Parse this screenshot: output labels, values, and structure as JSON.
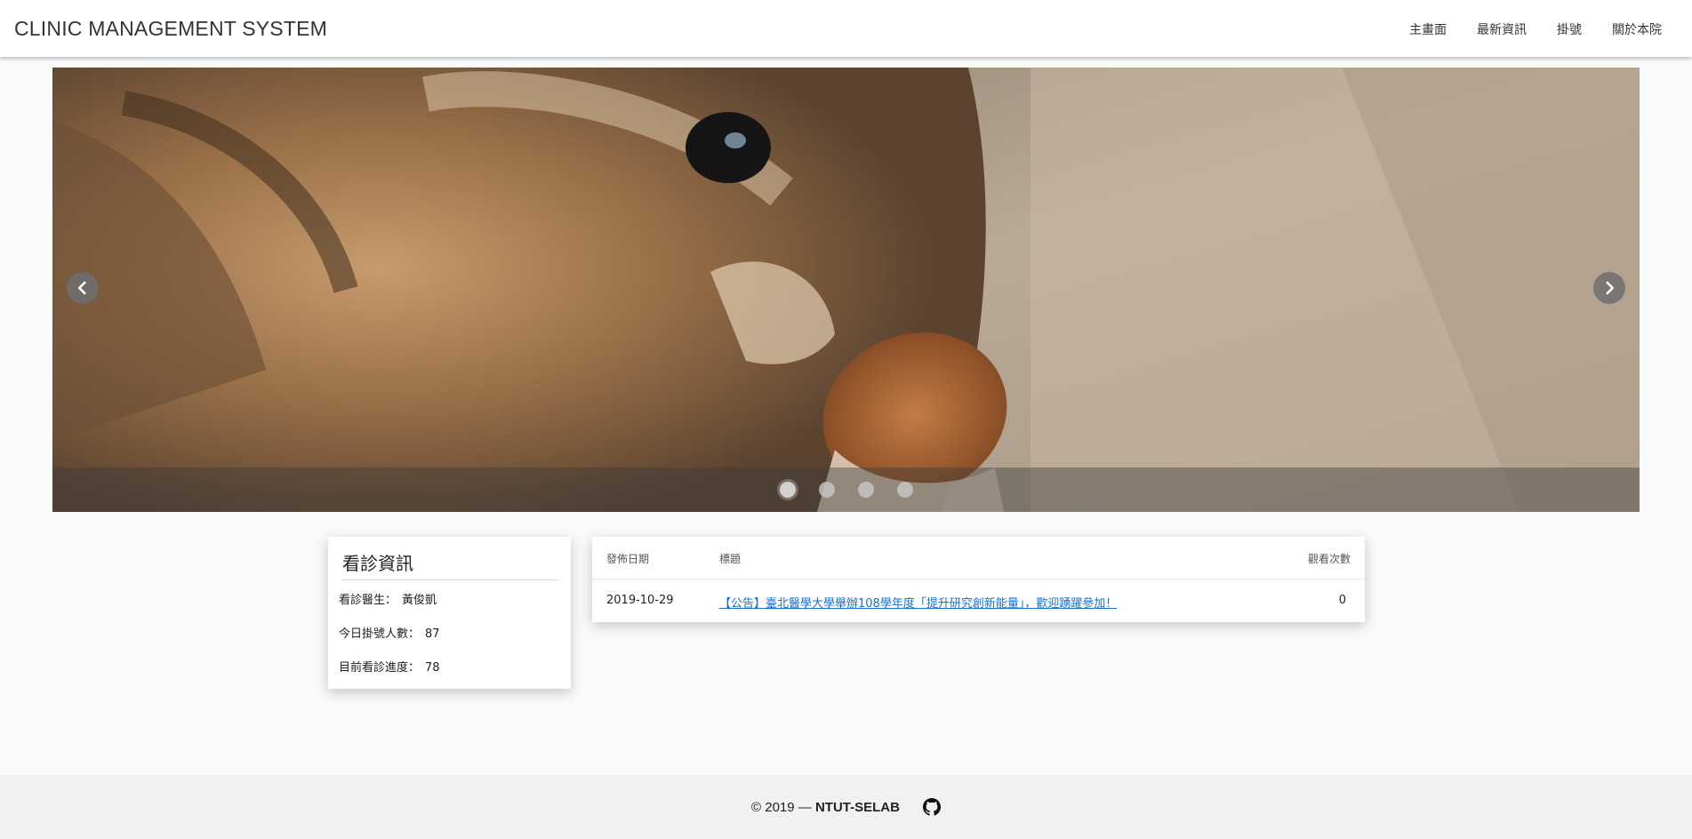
{
  "header": {
    "brand": "CLINIC MANAGEMENT SYSTEM",
    "nav": [
      {
        "label": "主畫面"
      },
      {
        "label": "最新資訊"
      },
      {
        "label": "掛號"
      },
      {
        "label": "關於本院"
      }
    ]
  },
  "carousel": {
    "slide_count": 4,
    "active_index": 0,
    "prev_icon": "chevron-left-icon",
    "next_icon": "chevron-right-icon"
  },
  "info": {
    "title": "看診資訊",
    "doctor_label": "看診醫生：",
    "doctor_value": "黃俊凱",
    "today_label": "今日掛號人數：",
    "today_value": "87",
    "progress_label": "目前看診進度：",
    "progress_value": "78"
  },
  "news": {
    "headers": {
      "date": "發佈日期",
      "title": "標題",
      "views": "觀看次數"
    },
    "rows": [
      {
        "date": "2019-10-29",
        "title": "【公告】臺北醫學大學舉辦108學年度「提升研究創新能量」，歡迎踴躍參加！",
        "views": "0"
      }
    ]
  },
  "footer": {
    "copyright": "© 2019 —",
    "org": "NTUT-SELAB",
    "icon": "github-icon"
  },
  "colors": {
    "link": "#1a6fd1",
    "footer_bg": "#f1f1f1",
    "page_bg": "#fafafa"
  }
}
